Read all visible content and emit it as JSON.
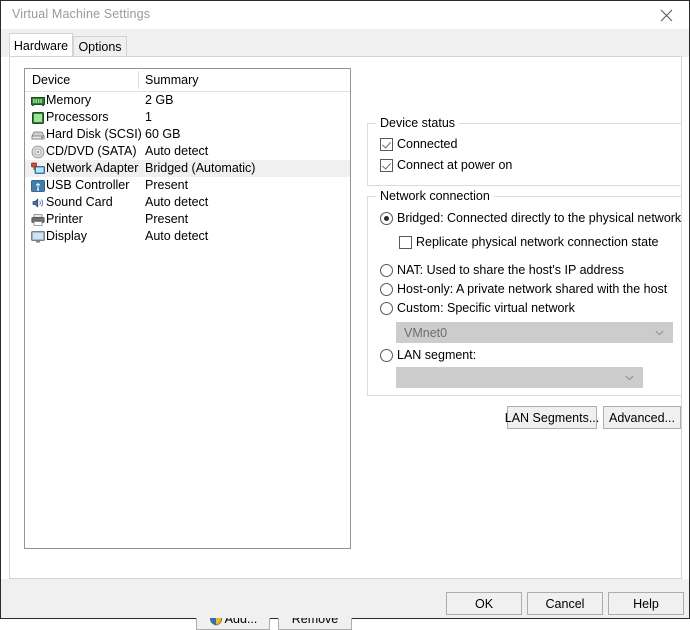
{
  "window": {
    "title": "Virtual Machine Settings",
    "close_icon": "close-icon"
  },
  "tabs": [
    {
      "label": "Hardware",
      "active": true
    },
    {
      "label": "Options",
      "active": false
    }
  ],
  "device_list": {
    "columns": [
      "Device",
      "Summary"
    ],
    "rows": [
      {
        "icon": "memory-icon",
        "device": "Memory",
        "summary": "2 GB",
        "selected": false
      },
      {
        "icon": "processor-icon",
        "device": "Processors",
        "summary": "1",
        "selected": false
      },
      {
        "icon": "hard-disk-icon",
        "device": "Hard Disk (SCSI)",
        "summary": "60 GB",
        "selected": false
      },
      {
        "icon": "cd-dvd-icon",
        "device": "CD/DVD (SATA)",
        "summary": "Auto detect",
        "selected": false
      },
      {
        "icon": "network-adapter-icon",
        "device": "Network Adapter",
        "summary": "Bridged (Automatic)",
        "selected": true
      },
      {
        "icon": "usb-controller-icon",
        "device": "USB Controller",
        "summary": "Present",
        "selected": false
      },
      {
        "icon": "sound-card-icon",
        "device": "Sound Card",
        "summary": "Auto detect",
        "selected": false
      },
      {
        "icon": "printer-icon",
        "device": "Printer",
        "summary": "Present",
        "selected": false
      },
      {
        "icon": "display-icon",
        "device": "Display",
        "summary": "Auto detect",
        "selected": false
      }
    ]
  },
  "list_buttons": {
    "add": "Add...",
    "add_icon": "uac-shield-icon",
    "remove": "Remove"
  },
  "device_status": {
    "legend": "Device status",
    "options": [
      {
        "label": "Connected",
        "checked": true
      },
      {
        "label": "Connect at power on",
        "checked": true
      }
    ]
  },
  "network_connection": {
    "legend": "Network connection",
    "bridged": {
      "label": "Bridged: Connected directly to the physical network",
      "selected": true
    },
    "replicate": {
      "label": "Replicate physical network connection state",
      "checked": false
    },
    "nat": {
      "label": "NAT: Used to share the host's IP address",
      "selected": false
    },
    "host_only": {
      "label": "Host-only: A private network shared with the host",
      "selected": false
    },
    "custom": {
      "label": "Custom: Specific virtual network",
      "selected": false,
      "combo_value": "VMnet0",
      "combo_disabled": true
    },
    "lan_segment": {
      "label": "LAN segment:",
      "selected": false,
      "combo_value": "",
      "combo_disabled": true
    }
  },
  "network_buttons": {
    "lan_segments": "LAN Segments...",
    "advanced": "Advanced..."
  },
  "dialog_buttons": {
    "ok": "OK",
    "cancel": "Cancel",
    "help": "Help"
  },
  "colors": {
    "window_bg": "#ffffff",
    "panel_bg": "#f0f0f0",
    "selection": "#f0f0f0",
    "border": "#d3d3d3",
    "list_border": "#959595",
    "disabled_combo": "#cccccc",
    "title_text": "#9a9a9a"
  }
}
